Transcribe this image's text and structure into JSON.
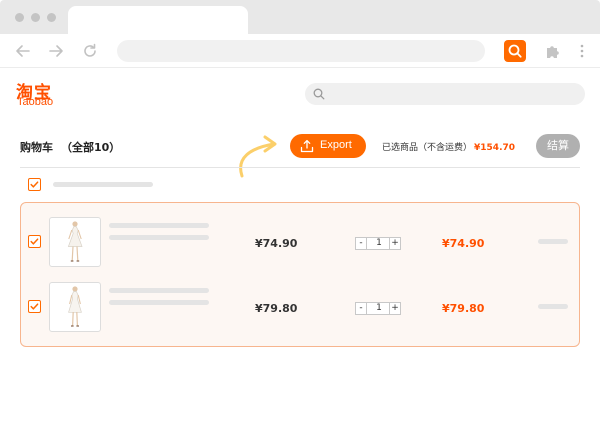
{
  "browser": {
    "nav_icons": [
      "back-arrow-icon",
      "forward-arrow-icon",
      "reload-icon"
    ],
    "extension_icons": [
      "search-icon",
      "puzzle-icon",
      "kebab-menu-icon"
    ]
  },
  "site": {
    "logo_cn": "淘宝",
    "logo_en": "Taobao",
    "brand_color": "#ff5000"
  },
  "cart": {
    "title": "购物车",
    "count_label": "（全部10）",
    "export_label": "Export",
    "selected_label": "已选商品（不含运费）",
    "selected_total": "¥154.70",
    "checkout_label": "结算",
    "items": [
      {
        "unit_price": "¥74.90",
        "quantity": "1",
        "line_total": "¥74.90",
        "checked": true
      },
      {
        "unit_price": "¥79.80",
        "quantity": "1",
        "line_total": "¥79.80",
        "checked": true
      }
    ],
    "minus_label": "-",
    "plus_label": "+"
  },
  "colors": {
    "accent": "#ff6a00",
    "price": "#ff5000",
    "disabled_button": "#b0b0b0"
  }
}
